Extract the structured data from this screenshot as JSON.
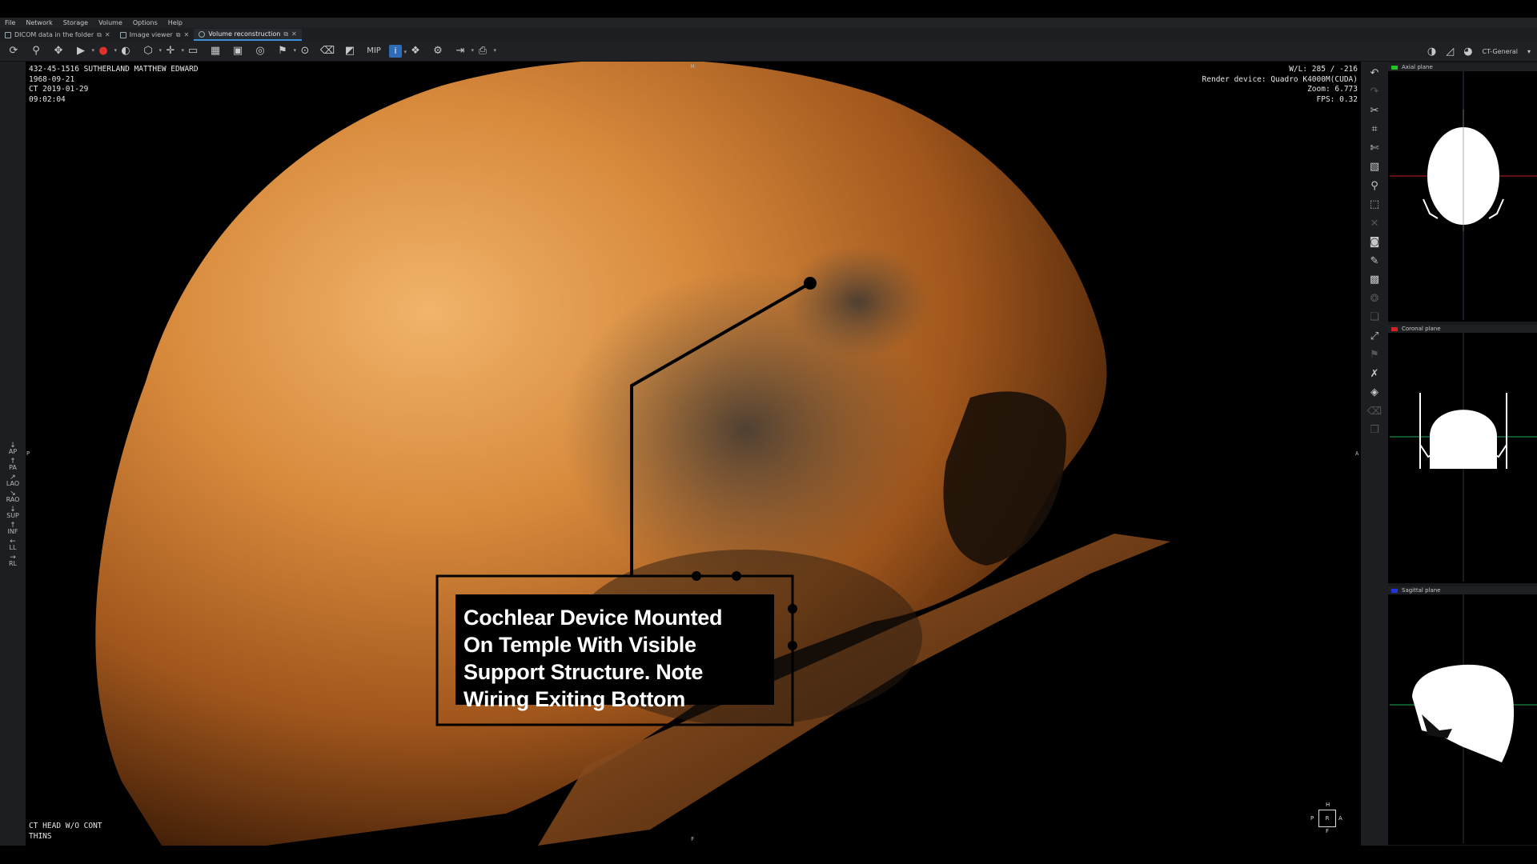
{
  "menu": [
    "File",
    "Network",
    "Storage",
    "Volume",
    "Options",
    "Help"
  ],
  "tabs": [
    {
      "label": "DICOM data in the folder",
      "active": false
    },
    {
      "label": "Image viewer",
      "active": false
    },
    {
      "label": "Volume reconstruction",
      "active": true
    }
  ],
  "toolbar": {
    "mip_label": "MIP",
    "preset_label": "CT-General"
  },
  "orientation_buttons": [
    "AP",
    "PA",
    "LAO",
    "RAO",
    "SUP",
    "INF",
    "LL",
    "RL"
  ],
  "overlay": {
    "patient_line": "432-45-1516 SUTHERLAND MATTHEW EDWARD",
    "birth_date": "1968-09-21",
    "study_line": "CT 2019-01-29",
    "study_time": "09:02:04",
    "wl": "W/L: 285 / -216",
    "render_device": "Render device: Quadro K4000M(CUDA)",
    "zoom": "Zoom: 6.773",
    "fps": "FPS: 0.32",
    "series_line1": "CT HEAD W/O CONT",
    "series_line2": "THINS"
  },
  "edge_markers": {
    "top": "H",
    "left": "P",
    "right": "A",
    "bottom": "F"
  },
  "orientation_cube": {
    "top": "H",
    "left": "P",
    "right": "A",
    "bottom": "F",
    "center": "R"
  },
  "annotation": {
    "line1": "Cochlear Device Mounted",
    "line2": "On Temple With Visible",
    "line3": "Support Structure. Note",
    "line4": "Wiring Exiting Bottom"
  },
  "planes": [
    {
      "title": "Axial plane",
      "color": "#22c322"
    },
    {
      "title": "Coronal plane",
      "color": "#d22222"
    },
    {
      "title": "Sagittal plane",
      "color": "#2233dd"
    }
  ],
  "colors": {
    "accent": "#3b8fd8",
    "bone": "#d98b3c",
    "record": "#e0302a"
  }
}
